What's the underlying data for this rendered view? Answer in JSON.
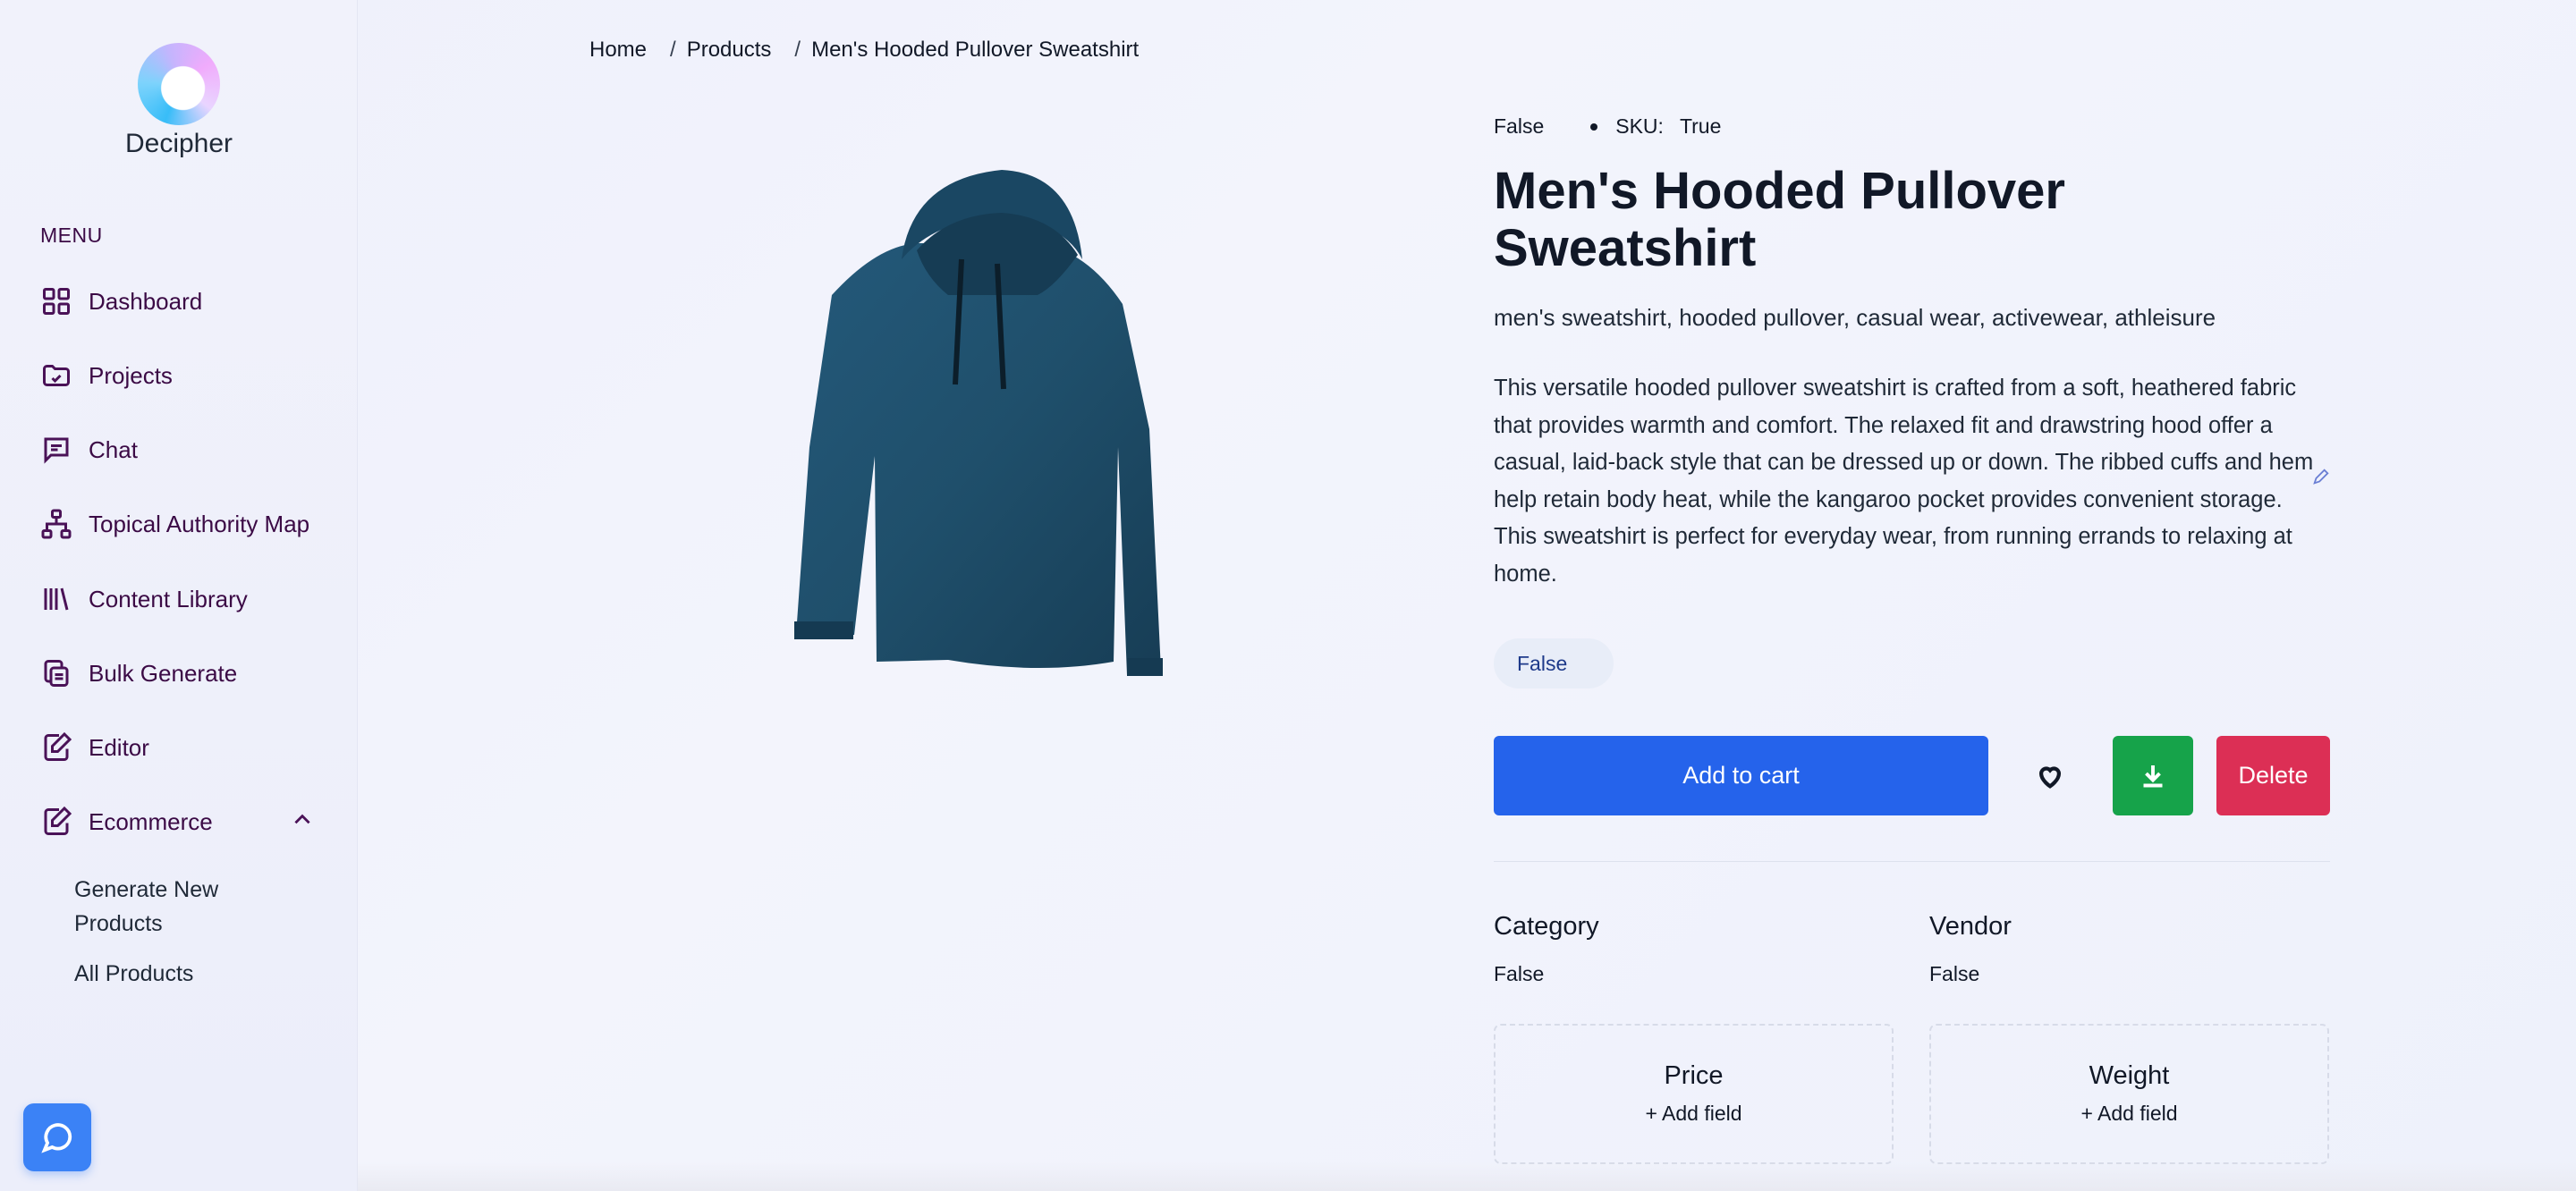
{
  "brand": {
    "name": "Decipher"
  },
  "sidebar": {
    "menu_label": "MENU",
    "items": [
      {
        "label": "Dashboard",
        "icon": "grid-icon"
      },
      {
        "label": "Projects",
        "icon": "folder-icon"
      },
      {
        "label": "Chat",
        "icon": "chat-icon"
      },
      {
        "label": "Topical Authority Map",
        "icon": "sitemap-icon"
      },
      {
        "label": "Content Library",
        "icon": "library-icon"
      },
      {
        "label": "Bulk Generate",
        "icon": "copy-icon"
      },
      {
        "label": "Editor",
        "icon": "edit-icon"
      },
      {
        "label": "Ecommerce",
        "icon": "edit-icon",
        "expanded": true
      }
    ],
    "sub_items": [
      {
        "label": "Generate New Products"
      },
      {
        "label": "All Products"
      }
    ]
  },
  "breadcrumb": {
    "home": "Home",
    "products": "Products",
    "current": "Men's Hooded Pullover Sweatshirt",
    "separator": "/"
  },
  "product": {
    "status": "False",
    "sku_label": "SKU:",
    "sku_value": "True",
    "title": "Men's Hooded Pullover Sweatshirt",
    "tags": "men's sweatshirt, hooded pullover, casual wear, activewear, athleisure",
    "description": "This versatile hooded pullover sweatshirt is crafted from a soft, heathered fabric that provides warmth and comfort. The relaxed fit and drawstring hood offer a casual, laid-back style that can be dressed up or down. The ribbed cuffs and hem help retain body heat, while the kangaroo pocket provides convenient storage. This sweatshirt is perfect for everyday wear, from running errands to relaxing at home.",
    "pill": "False",
    "image_color": "#1f4f6b"
  },
  "actions": {
    "add_to_cart": "Add to cart",
    "delete": "Delete"
  },
  "fields": {
    "category_label": "Category",
    "category_value": "False",
    "vendor_label": "Vendor",
    "vendor_value": "False",
    "price_label": "Price",
    "price_add": "+ Add field",
    "weight_label": "Weight",
    "weight_add": "+ Add field"
  },
  "colors": {
    "primary": "#2563eb",
    "success": "#16a34a",
    "danger": "#dc2f55",
    "sidebar_text": "#3b0a45"
  }
}
